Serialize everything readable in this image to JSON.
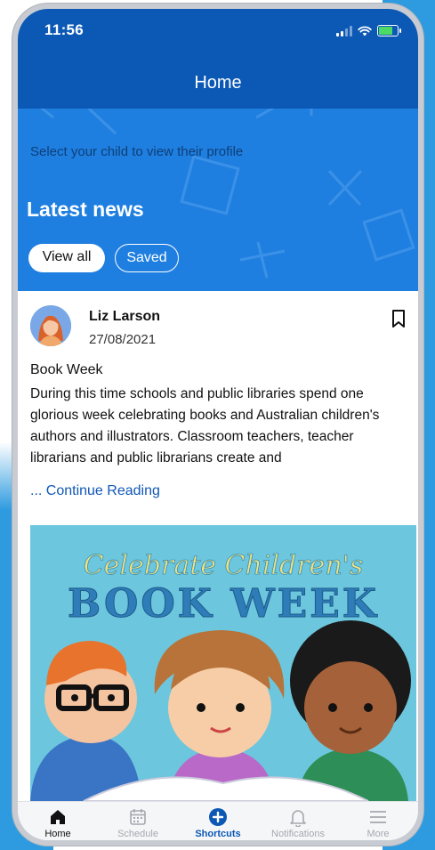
{
  "status_bar": {
    "time": "11:56",
    "battery_level": 0.7
  },
  "header": {
    "title": "Home"
  },
  "hero": {
    "subtitle": "Select your child to view their profile",
    "heading": "Latest news",
    "chips": {
      "view_all": "View all",
      "saved": "Saved"
    }
  },
  "post": {
    "author": "Liz Larson",
    "date": "27/08/2021",
    "title": "Book Week",
    "body": "During this time schools and public libraries spend one glorious week celebrating books and Australian children's authors and illustrators. Classroom teachers, teacher librarians and public librarians create and",
    "continue": "... Continue Reading",
    "image": {
      "line1": "Celebrate Children's",
      "line2": "BOOK WEEK"
    }
  },
  "tabbar": {
    "items": [
      {
        "label": "Home",
        "icon": "home-icon"
      },
      {
        "label": "Schedule",
        "icon": "calendar-icon"
      },
      {
        "label": "Shortcuts",
        "icon": "plus-circle-icon"
      },
      {
        "label": "Notifications",
        "icon": "bell-icon"
      },
      {
        "label": "More",
        "icon": "menu-icon"
      }
    ]
  },
  "colors": {
    "header_blue": "#0b58b5",
    "hero_blue": "#1f7fe0",
    "link_blue": "#1158b7",
    "image_bg": "#6cc6dd"
  }
}
